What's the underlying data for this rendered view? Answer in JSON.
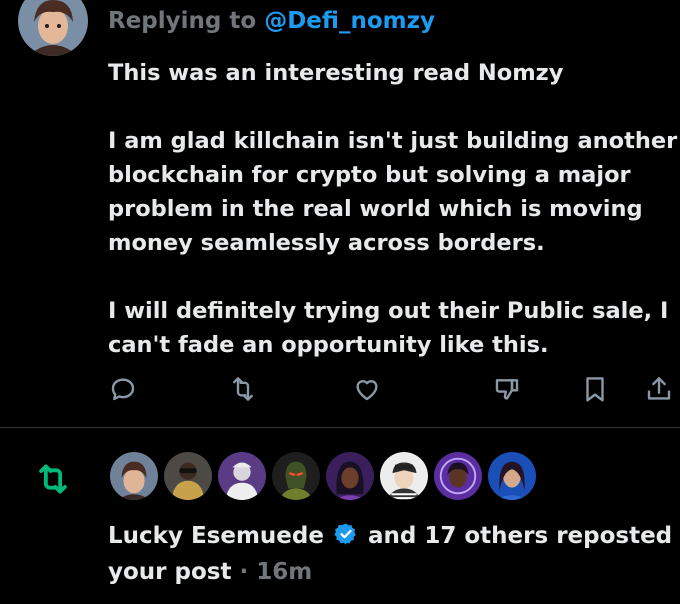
{
  "reply": {
    "prefix": "Replying to",
    "handle": "@Defi_nomzy"
  },
  "tweet": {
    "paragraphs": [
      [
        "This was an interesting read Nomzy"
      ],
      [
        "I am glad killchain isn't just building another",
        "blockchain for crypto but solving a major",
        "problem in the real world which is moving",
        "money seamlessly across borders."
      ],
      [
        "I will definitely trying out their Public sale, I",
        "can't fade an opportunity like this."
      ]
    ]
  },
  "actions": {
    "icons": [
      "reply-icon",
      "repost-icon",
      "like-icon",
      "dislike-icon",
      "bookmark-icon",
      "share-icon"
    ]
  },
  "notification": {
    "icon": "repost-icon",
    "name": "Lucky Esemuede",
    "rest_line1": "and 17 others reposted",
    "line2": "your post",
    "separator": "·",
    "time": "16m"
  },
  "colors": {
    "background": "#000000",
    "text": "#e7e9ea",
    "muted": "#71767b",
    "link": "#1d9bf0",
    "repost_green": "#00ba7c",
    "divider": "#2f3336"
  }
}
